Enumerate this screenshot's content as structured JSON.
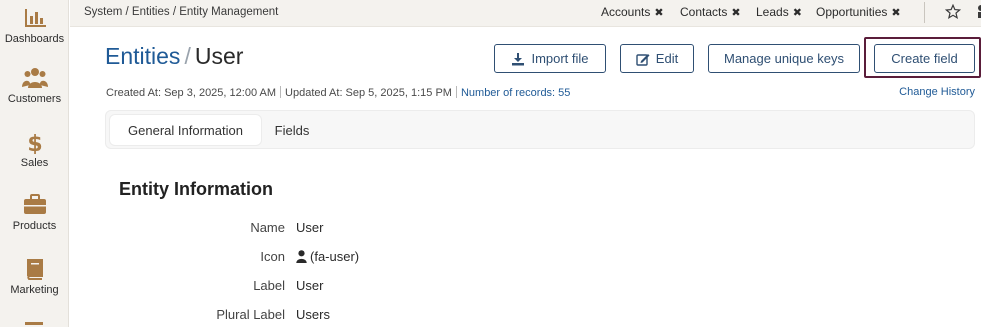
{
  "sidebar": {
    "items": [
      {
        "label": "Dashboards",
        "icon": "bar-chart-icon"
      },
      {
        "label": "Customers",
        "icon": "users-icon"
      },
      {
        "label": "Sales",
        "icon": "dollar-icon"
      },
      {
        "label": "Products",
        "icon": "briefcase-icon"
      },
      {
        "label": "Marketing",
        "icon": "book-icon"
      }
    ]
  },
  "topbar": {
    "breadcrumb": "System / Entities / Entity Management",
    "quick_tabs": [
      "Accounts",
      "Contacts",
      "Leads",
      "Opportunities"
    ],
    "close_glyph": "✖"
  },
  "header": {
    "root": "Entities",
    "separator": "/",
    "current": "User"
  },
  "toolbar": {
    "import_label": "Import file",
    "edit_label": "Edit",
    "manage_label": "Manage unique keys",
    "create_label": "Create field"
  },
  "meta": {
    "created": "Created At: Sep 3, 2025, 12:00 AM",
    "updated": "Updated At: Sep 5, 2025, 1:15 PM",
    "records": "Number of records: 55",
    "change_history": "Change History"
  },
  "tabs": [
    {
      "label": "General Information",
      "active": true
    },
    {
      "label": "Fields",
      "active": false
    }
  ],
  "section": {
    "title": "Entity Information",
    "rows": [
      {
        "key": "Name",
        "value": "User"
      },
      {
        "key": "Icon",
        "value": "(fa-user)"
      },
      {
        "key": "Label",
        "value": "User"
      },
      {
        "key": "Plural Label",
        "value": "Users"
      }
    ]
  },
  "colors": {
    "brand": "#1f5a96",
    "sidebar_icon": "#a97b45",
    "button_border": "#2f4f73",
    "focus": "#5a1d3a"
  }
}
